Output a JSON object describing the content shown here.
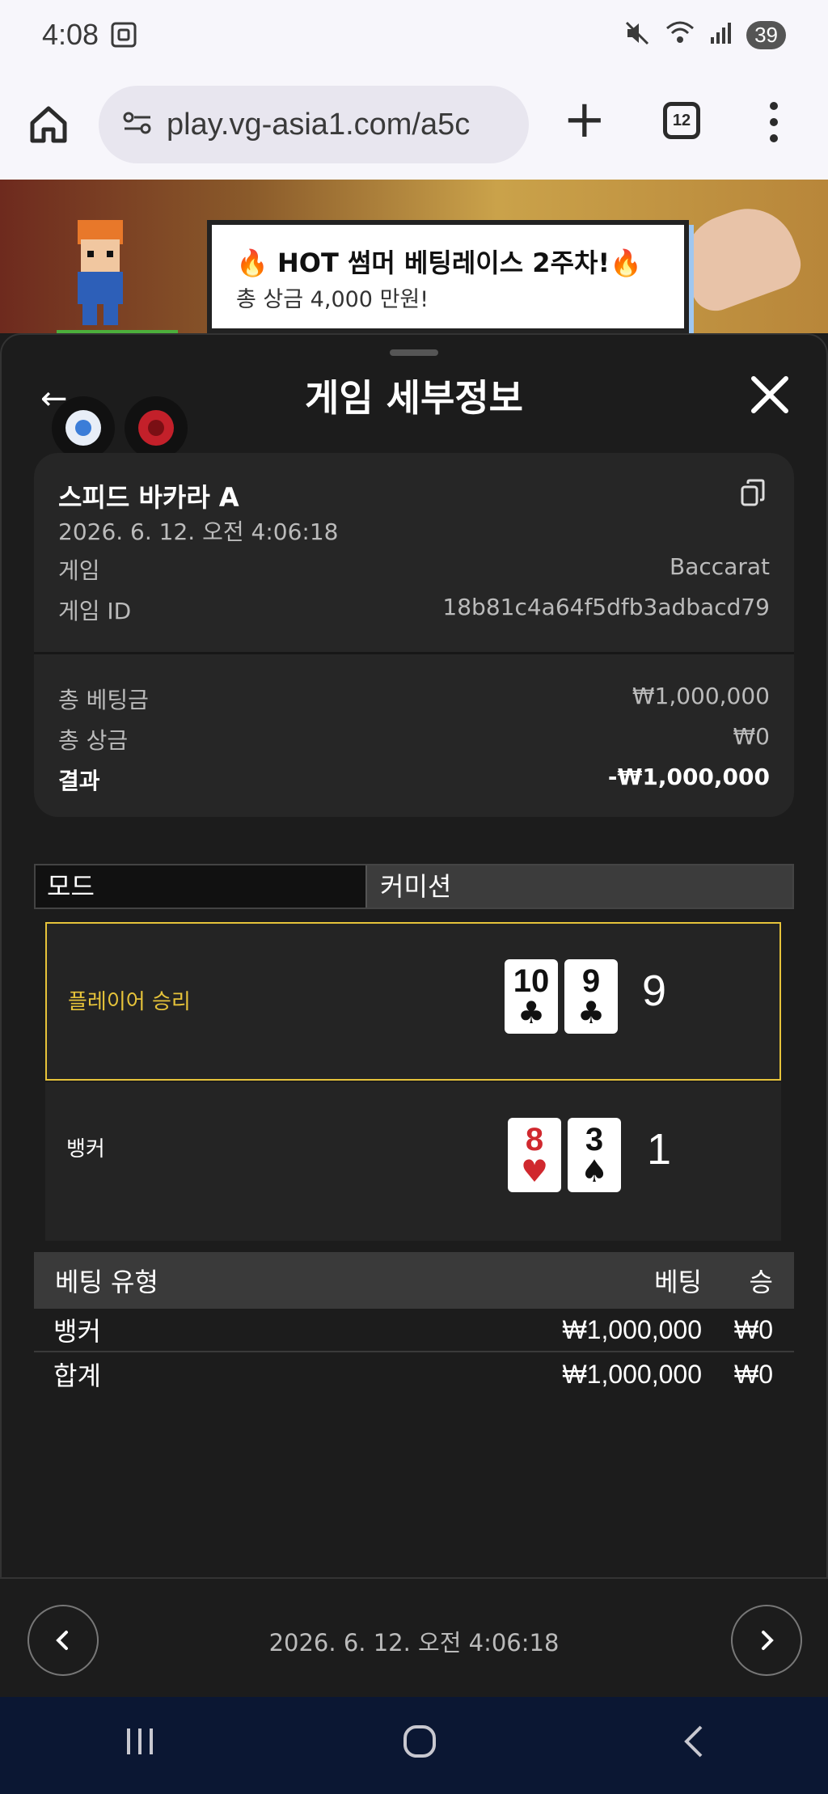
{
  "status": {
    "time": "4:08",
    "battery": "39"
  },
  "browser": {
    "url": "play.vg-asia1.com/a5c",
    "tab_count": "12"
  },
  "promo": {
    "line1": "🔥 HOT 썸머 베팅레이스 2주차!🔥",
    "line2": "총 상금 4,000 만원!"
  },
  "sheet": {
    "title": "게임 세부정보"
  },
  "game": {
    "name": "스피드 바카라 A",
    "datetime": "2026. 6. 12. 오전 4:06:18",
    "game_label": "게임",
    "game_value": "Baccarat",
    "id_label": "게임 ID",
    "id_value": "18b81c4a64f5dfb3adbacd79",
    "total_bet_label": "총 베팅금",
    "total_bet": "₩1,000,000",
    "total_win_label": "총 상금",
    "total_win": "₩0",
    "result_label": "결과",
    "result": "-₩1,000,000"
  },
  "mode": {
    "label": "모드",
    "value": "커미션"
  },
  "hands": {
    "player": {
      "label": "플레이어 승리",
      "cards": [
        {
          "rank": "10",
          "suit": "♣"
        },
        {
          "rank": "9",
          "suit": "♣"
        }
      ],
      "score": "9"
    },
    "banker": {
      "label": "뱅커",
      "cards": [
        {
          "rank": "8",
          "suit": "♥"
        },
        {
          "rank": "3",
          "suit": "♠"
        }
      ],
      "score": "1"
    }
  },
  "bets": {
    "headers": {
      "type": "베팅 유형",
      "bet": "베팅",
      "win": "승"
    },
    "rows": [
      {
        "type": "뱅커",
        "bet": "₩1,000,000",
        "win": "₩0"
      }
    ],
    "total": {
      "type": "합계",
      "bet": "₩1,000,000",
      "win": "₩0"
    }
  },
  "footer": {
    "datetime": "2026. 6. 12. 오전 4:06:18"
  },
  "colors": {
    "win_border": "#e6c33a",
    "win_text": "#e6c33a",
    "red_suit": "#d0282e",
    "black_suit": "#111111"
  }
}
